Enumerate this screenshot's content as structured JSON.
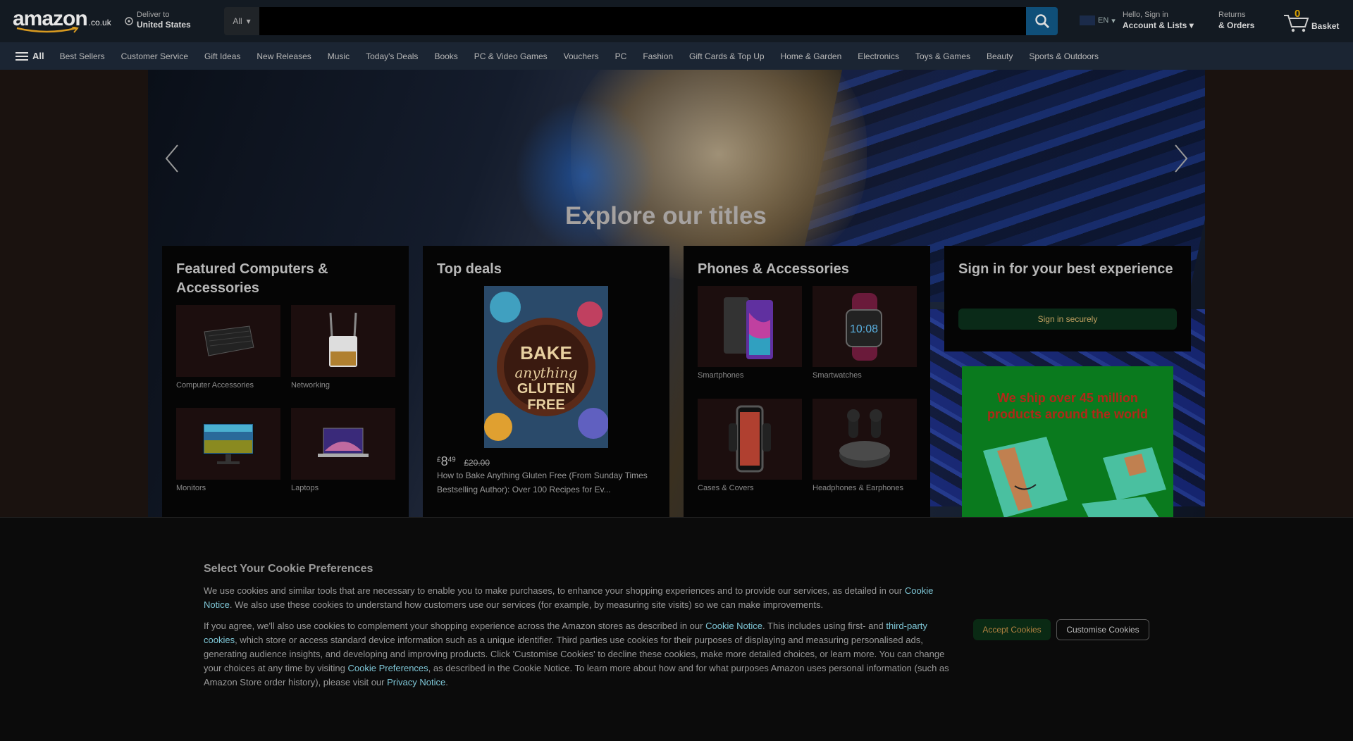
{
  "header": {
    "logo_text": "amazon",
    "logo_tld": ".co.uk",
    "deliver_line1": "Deliver to",
    "deliver_line2": "United States",
    "search_category": "All",
    "search_placeholder": "",
    "lang_code": "EN",
    "account_line1": "Hello, Sign in",
    "account_line2": "Account & Lists",
    "returns_line1": "Returns",
    "returns_line2": "& Orders",
    "basket_count": "0",
    "basket_label": "Basket"
  },
  "subnav": {
    "all_label": "All",
    "items": [
      "Best Sellers",
      "Customer Service",
      "Gift Ideas",
      "New Releases",
      "Music",
      "Today's Deals",
      "Books",
      "PC & Video Games",
      "Vouchers",
      "PC",
      "Fashion",
      "Gift Cards & Top Up",
      "Home & Garden",
      "Electronics",
      "Toys & Games",
      "Beauty",
      "Sports & Outdoors"
    ]
  },
  "hero": {
    "title": "Explore our titles"
  },
  "cards": {
    "computers": {
      "title": "Featured Computers & Accessories",
      "tiles": [
        "Computer Accessories",
        "Networking",
        "Monitors",
        "Laptops"
      ]
    },
    "deals": {
      "title": "Top deals",
      "price_symbol": "£",
      "price_whole": "8",
      "price_fraction": "49",
      "was_price": "£20.00",
      "book_title": "How to Bake Anything Gluten Free (From Sunday Times Bestselling Author): Over 100 Recipes for Ev...",
      "cover_line1": "BAKE",
      "cover_line2": "anything",
      "cover_line3": "GLUTEN",
      "cover_line4": "FREE"
    },
    "phones": {
      "title": "Phones & Accessories",
      "tiles": [
        "Smartphones",
        "Smartwatches",
        "Cases & Covers",
        "Headphones & Earphones"
      ]
    },
    "signin": {
      "title": "Sign in for your best experience",
      "button": "Sign in securely"
    },
    "ship": {
      "text": "We ship over 45 million products around the world"
    }
  },
  "cookie": {
    "title": "Select Your Cookie Preferences",
    "p1_a": "We use cookies and similar tools that are necessary to enable you to make purchases, to enhance your shopping experiences and to provide our services, as detailed in our ",
    "p1_link": "Cookie Notice",
    "p1_b": ". We also use these cookies to understand how customers use our services (for example, by measuring site visits) so we can make improvements.",
    "p2_a": "If you agree, we'll also use cookies to complement your shopping experience across the Amazon stores as described in our ",
    "p2_link1": "Cookie Notice",
    "p2_b": ". This includes using first- and ",
    "p2_link2": "third-party cookies",
    "p2_c": ", which store or access standard device information such as a unique identifier. Third parties use cookies for their purposes of displaying and measuring personalised ads, generating audience insights, and developing and improving products. Click 'Customise Cookies' to decline these cookies, make more detailed choices, or learn more. You can change your choices at any time by visiting ",
    "p2_link3": "Cookie Preferences",
    "p2_d": ", as described in the Cookie Notice. To learn more about how and for what purposes Amazon uses personal information (such as Amazon Store order history), please visit our ",
    "p2_link4": "Privacy Notice",
    "p2_e": ".",
    "accept": "Accept Cookies",
    "customise": "Customise Cookies"
  }
}
